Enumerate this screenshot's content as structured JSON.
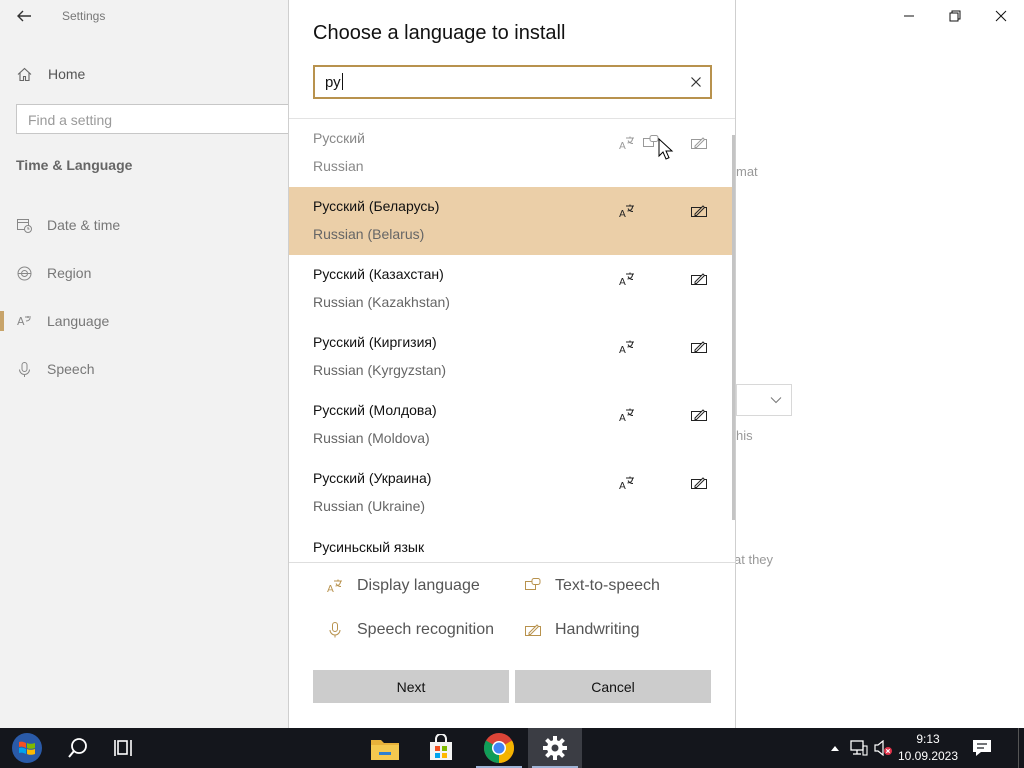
{
  "settings": {
    "title": "Settings",
    "home_label": "Home",
    "find_placeholder": "Find a setting",
    "section_title": "Time & Language",
    "nav": [
      {
        "label": "Date & time",
        "icon": "calendar-clock-icon"
      },
      {
        "label": "Region",
        "icon": "globe-icon"
      },
      {
        "label": "Language",
        "icon": "language-icon"
      },
      {
        "label": "Speech",
        "icon": "microphone-icon"
      }
    ],
    "active_nav": "Language",
    "background_fragments": {
      "format": "mat",
      "this": "his",
      "they": "at they"
    }
  },
  "dialog": {
    "title": "Choose a language to install",
    "search_value": "ру",
    "languages": [
      {
        "native": "Русский",
        "english": "Russian",
        "features": [
          "display",
          "tts",
          "handwriting"
        ],
        "state": "faded"
      },
      {
        "native": "Русский (Беларусь)",
        "english": "Russian (Belarus)",
        "features": [
          "display",
          "handwriting"
        ],
        "state": "selected"
      },
      {
        "native": "Русский (Казахстан)",
        "english": "Russian (Kazakhstan)",
        "features": [
          "display",
          "handwriting"
        ],
        "state": "normal"
      },
      {
        "native": "Русский (Киргизия)",
        "english": "Russian (Kyrgyzstan)",
        "features": [
          "display",
          "handwriting"
        ],
        "state": "normal"
      },
      {
        "native": "Русский (Молдова)",
        "english": "Russian (Moldova)",
        "features": [
          "display",
          "handwriting"
        ],
        "state": "normal"
      },
      {
        "native": "Русский (Украина)",
        "english": "Russian (Ukraine)",
        "features": [
          "display",
          "handwriting"
        ],
        "state": "normal"
      },
      {
        "native": "Русиньскый язык",
        "english": "",
        "features": [],
        "state": "normal"
      }
    ],
    "legend": {
      "display": "Display language",
      "tts": "Text-to-speech",
      "speech": "Speech recognition",
      "handwriting": "Handwriting"
    },
    "next_label": "Next",
    "cancel_label": "Cancel",
    "accent_color": "#b8924d",
    "selected_row_color": "#ebcfa8"
  },
  "taskbar": {
    "time": "9:13",
    "date": "10.09.2023",
    "pinned": [
      "start-button",
      "search-icon",
      "task-view-icon",
      "file-explorer-icon",
      "store-icon",
      "chrome-icon",
      "settings-icon"
    ],
    "active_app": "settings-icon"
  }
}
